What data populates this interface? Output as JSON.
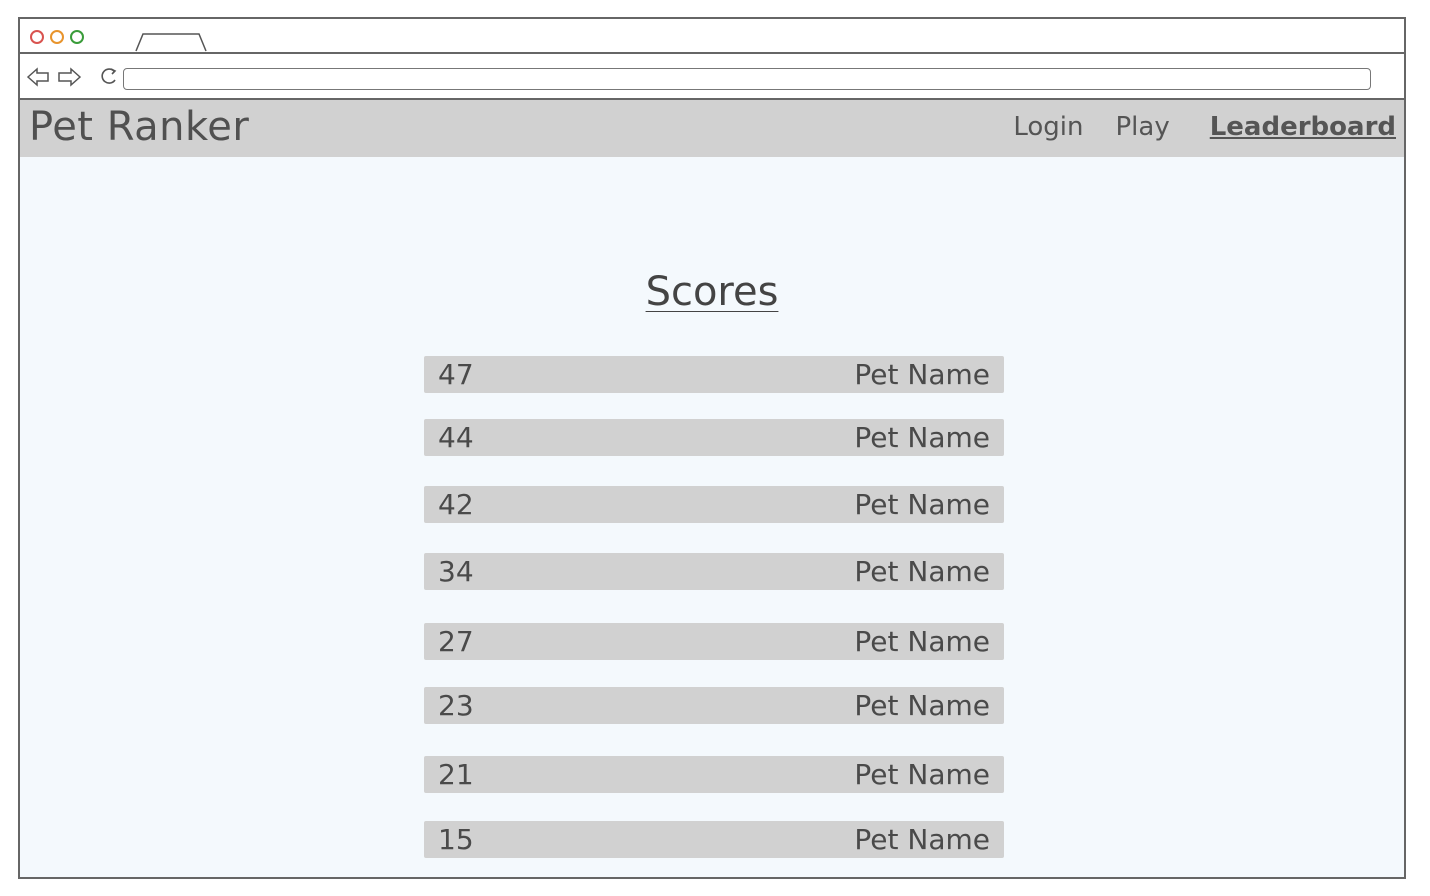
{
  "browser": {
    "url": ""
  },
  "navbar": {
    "brand": "Pet Ranker",
    "links": [
      {
        "label": "Login"
      },
      {
        "label": "Play"
      },
      {
        "label": "Leaderboard"
      }
    ]
  },
  "main": {
    "title": "Scores",
    "scores": [
      {
        "score": "47",
        "name": "Pet Name"
      },
      {
        "score": "44",
        "name": "Pet Name"
      },
      {
        "score": "42",
        "name": "Pet Name"
      },
      {
        "score": "34",
        "name": "Pet Name"
      },
      {
        "score": "27",
        "name": "Pet Name"
      },
      {
        "score": "23",
        "name": "Pet Name"
      },
      {
        "score": "21",
        "name": "Pet Name"
      },
      {
        "score": "15",
        "name": "Pet Name"
      }
    ]
  }
}
